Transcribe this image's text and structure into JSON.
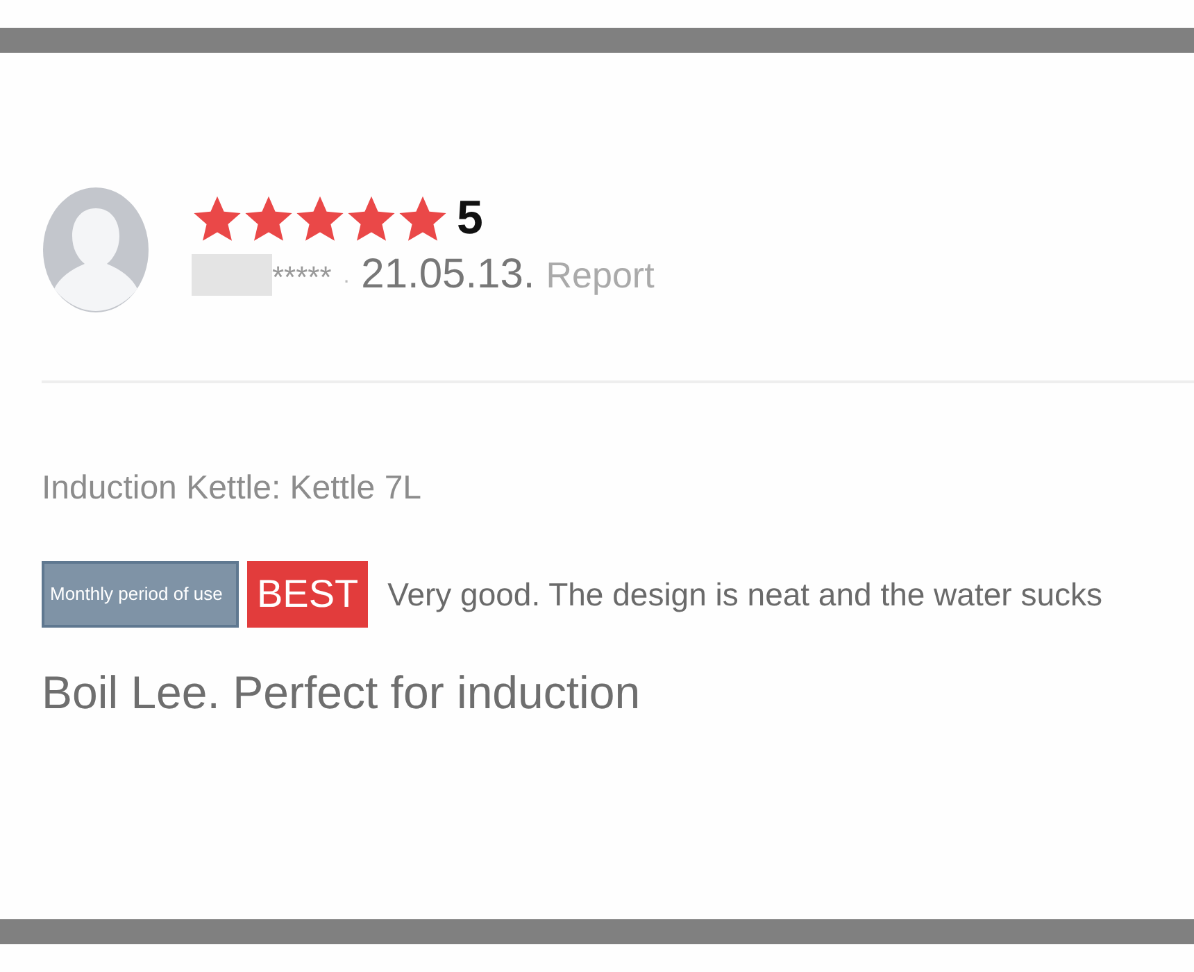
{
  "review": {
    "stars": 5,
    "score": "5",
    "author": "*****",
    "separator": "·",
    "date": "21.05.13.",
    "report": "Report"
  },
  "option": "Induction Kettle: Kettle 7L",
  "badges": [
    {
      "kind": "period",
      "label": "Monthly period of use"
    },
    {
      "kind": "best",
      "label": "BEST"
    }
  ],
  "summary": "Very good. The design is neat and the water sucks",
  "body": "Boil Lee. Perfect for induction"
}
